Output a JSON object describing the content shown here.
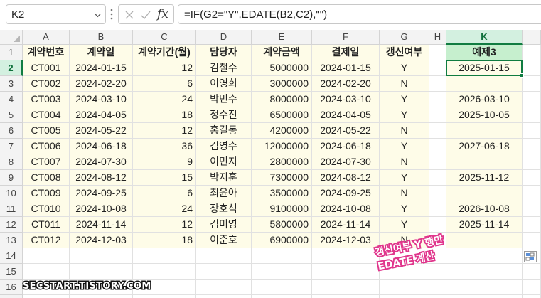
{
  "formula_bar": {
    "name_box": "K2",
    "fx_label": "fx",
    "formula": "=IF(G2=\"Y\",EDATE(B2,C2),\"\")"
  },
  "grid": {
    "columns": [
      "A",
      "B",
      "C",
      "D",
      "E",
      "F",
      "G",
      "H",
      "K"
    ],
    "selected_column": "K",
    "selected_row": "2",
    "row_numbers": [
      "1",
      "2",
      "3",
      "4",
      "5",
      "6",
      "7",
      "8",
      "9",
      "10",
      "11",
      "12",
      "13",
      "14",
      "15",
      "16",
      "17"
    ],
    "headers": {
      "A": "계약번호",
      "B": "계약일",
      "C": "계약기간(월)",
      "D": "담당자",
      "E": "계약금액",
      "F": "결제일",
      "G": "갱신여부",
      "K": "예제3"
    },
    "rows": [
      {
        "A": "CT001",
        "B": "2024-01-15",
        "C": "12",
        "D": "김철수",
        "E": "5000000",
        "F": "2024-01-15",
        "G": "Y",
        "K": "2025-01-15"
      },
      {
        "A": "CT002",
        "B": "2024-02-20",
        "C": "6",
        "D": "이영희",
        "E": "3000000",
        "F": "2024-02-20",
        "G": "N",
        "K": ""
      },
      {
        "A": "CT003",
        "B": "2024-03-10",
        "C": "24",
        "D": "박민수",
        "E": "8000000",
        "F": "2024-03-10",
        "G": "Y",
        "K": "2026-03-10"
      },
      {
        "A": "CT004",
        "B": "2024-04-05",
        "C": "18",
        "D": "정수진",
        "E": "6500000",
        "F": "2024-04-05",
        "G": "Y",
        "K": "2025-10-05"
      },
      {
        "A": "CT005",
        "B": "2024-05-22",
        "C": "12",
        "D": "홍길동",
        "E": "4200000",
        "F": "2024-05-22",
        "G": "N",
        "K": ""
      },
      {
        "A": "CT006",
        "B": "2024-06-18",
        "C": "36",
        "D": "김영수",
        "E": "12000000",
        "F": "2024-06-18",
        "G": "Y",
        "K": "2027-06-18"
      },
      {
        "A": "CT007",
        "B": "2024-07-30",
        "C": "9",
        "D": "이민지",
        "E": "2800000",
        "F": "2024-07-30",
        "G": "N",
        "K": ""
      },
      {
        "A": "CT008",
        "B": "2024-08-12",
        "C": "15",
        "D": "박지훈",
        "E": "7300000",
        "F": "2024-08-12",
        "G": "Y",
        "K": "2025-11-12"
      },
      {
        "A": "CT009",
        "B": "2024-09-25",
        "C": "6",
        "D": "최윤아",
        "E": "3500000",
        "F": "2024-09-25",
        "G": "N",
        "K": ""
      },
      {
        "A": "CT010",
        "B": "2024-10-08",
        "C": "24",
        "D": "장호석",
        "E": "9100000",
        "F": "2024-10-08",
        "G": "Y",
        "K": "2026-10-08"
      },
      {
        "A": "CT011",
        "B": "2024-11-14",
        "C": "12",
        "D": "김미영",
        "E": "5800000",
        "F": "2024-11-14",
        "G": "Y",
        "K": "2025-11-14"
      },
      {
        "A": "CT012",
        "B": "2024-12-03",
        "C": "18",
        "D": "이준호",
        "E": "6900000",
        "F": "2024-12-03",
        "G": "N",
        "K": ""
      }
    ]
  },
  "annotation": {
    "line1": "갱신여부 Y 행만",
    "line2": "EDATE 계산"
  },
  "watermark": "SECSTART.TISTORY.COM",
  "colors": {
    "accent": "#107c41",
    "selected_header_bg": "#d3f0e0",
    "data_fill": "#fefce8",
    "k_header_fill": "#c6efce",
    "annotation": "#e0368c"
  }
}
